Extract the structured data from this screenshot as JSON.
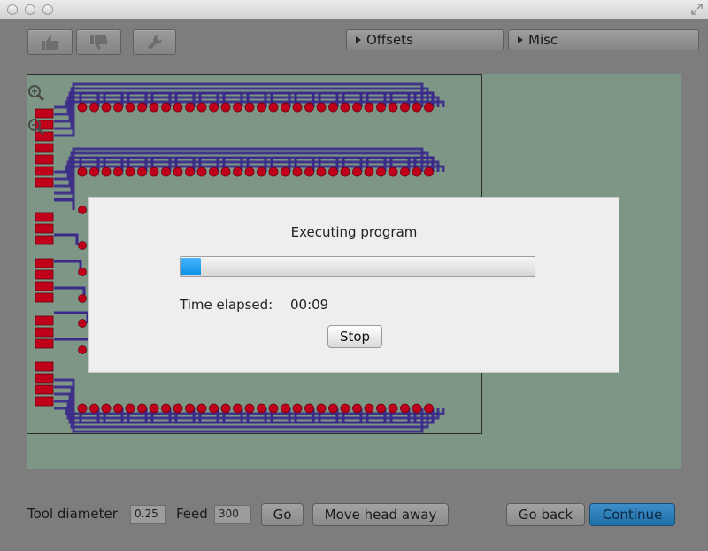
{
  "toolbar": {
    "offsets_label": "Offsets",
    "misc_label": "Misc",
    "icons": [
      "thumbs-up-icon",
      "thumbs-down-icon",
      "wrench-icon"
    ]
  },
  "board": {
    "trace_color": "#3b2a8a",
    "pad_color": "#c0001a"
  },
  "bottom": {
    "tool_diameter_label": "Tool diameter",
    "tool_diameter_value": "0.25",
    "feed_label": "Feed",
    "feed_value": "300",
    "go_label": "Go",
    "move_head_label": "Move head away",
    "go_back_label": "Go back",
    "continue_label": "Continue"
  },
  "dialog": {
    "title": "Executing program",
    "progress_fraction": 0.055,
    "elapsed_label": "Time elapsed:",
    "elapsed_value": "00:09",
    "stop_label": "Stop"
  },
  "colors": {
    "accent": "#1f6ea8",
    "canvas": "#7d9686",
    "progress": "#0a8fe6"
  }
}
